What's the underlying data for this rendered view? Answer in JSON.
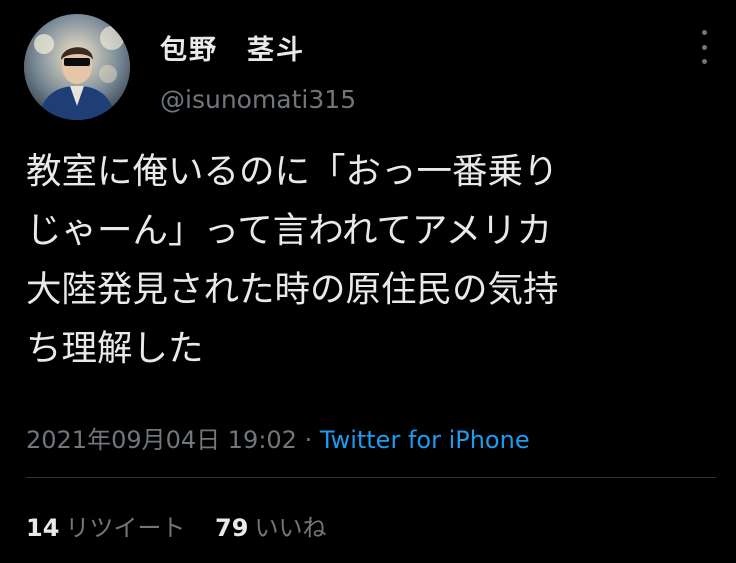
{
  "user": {
    "display_name": "包野　茎斗",
    "handle": "@isunomati315"
  },
  "tweet": {
    "lines": [
      "教室に俺いるのに「おっ一番乗り",
      "じゃーん」って言われてアメリカ",
      "大陸発見された時の原住民の気持",
      "ち理解した"
    ],
    "timestamp": "2021年09月04日 19:02",
    "separator": "·",
    "source": "Twitter for iPhone"
  },
  "stats": {
    "retweets_count": "14",
    "retweets_label": "リツイート",
    "likes_count": "79",
    "likes_label": "いいね"
  },
  "colors": {
    "background": "#000000",
    "text": "#e7e9ea",
    "muted": "#71767b",
    "link": "#1d9bf0"
  }
}
